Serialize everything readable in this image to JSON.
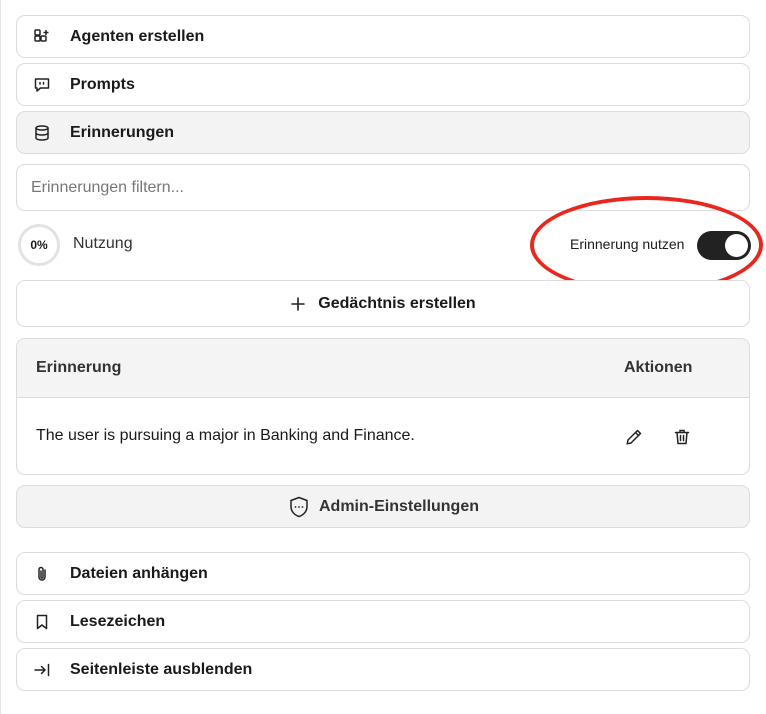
{
  "top_nav": [
    {
      "label": "Agenten erstellen",
      "icon": "apps-add-icon"
    },
    {
      "label": "Prompts",
      "icon": "message-quote-icon"
    },
    {
      "label": "Erinnerungen",
      "icon": "database-icon",
      "active": true
    }
  ],
  "memories": {
    "filter_placeholder": "Erinnerungen filtern...",
    "usage_percent": "0%",
    "usage_label": "Nutzung",
    "toggle_label": "Erinnerung nutzen",
    "toggle_on": true,
    "create_label": "Gedächtnis erstellen",
    "table": {
      "headers": {
        "memory": "Erinnerung",
        "actions": "Aktionen"
      },
      "rows": [
        {
          "text": "The user is pursuing a major in Banking and Finance."
        }
      ]
    },
    "admin_label": "Admin-Einstellungen"
  },
  "bottom_nav": [
    {
      "label": "Dateien anhängen",
      "icon": "paperclip-icon"
    },
    {
      "label": "Lesezeichen",
      "icon": "bookmark-icon"
    },
    {
      "label": "Seitenleiste ausblenden",
      "icon": "collapse-sidebar-icon"
    }
  ],
  "colors": {
    "highlight": "#e8271e",
    "toggle_track": "#222222"
  }
}
